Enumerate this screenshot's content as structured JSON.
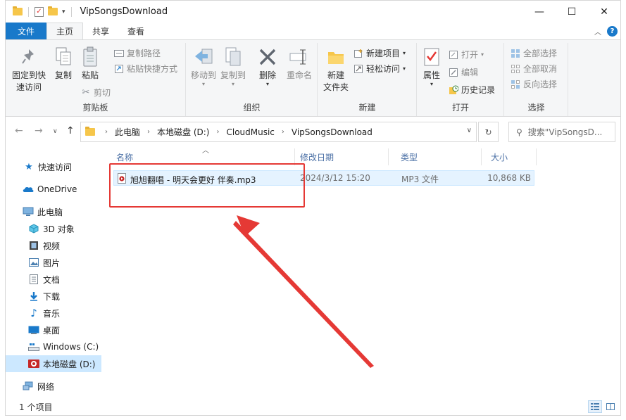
{
  "window": {
    "title": "VipSongsDownload",
    "controls": {
      "minimize": "—",
      "maximize": "☐",
      "close": "✕"
    }
  },
  "tabs": [
    {
      "label": "文件"
    },
    {
      "label": "主页"
    },
    {
      "label": "共享"
    },
    {
      "label": "查看"
    }
  ],
  "ribbon": {
    "clipboard": {
      "label": "剪贴板",
      "pin": "固定到快\n速访问",
      "copy": "复制",
      "paste": "粘贴",
      "copy_path": "复制路径",
      "paste_shortcut": "粘贴快捷方式",
      "cut": "剪切"
    },
    "organize": {
      "label": "组织",
      "move_to": "移动到",
      "copy_to": "复制到",
      "delete": "删除",
      "rename": "重命名"
    },
    "new": {
      "label": "新建",
      "new_folder": "新建\n文件夹",
      "new_item": "新建项目",
      "easy_access": "轻松访问"
    },
    "open": {
      "label": "打开",
      "properties": "属性",
      "open": "打开",
      "edit": "编辑",
      "history": "历史记录"
    },
    "select": {
      "label": "选择",
      "select_all": "全部选择",
      "select_none": "全部取消",
      "invert": "反向选择"
    }
  },
  "address": {
    "crumbs": [
      "此电脑",
      "本地磁盘 (D:)",
      "CloudMusic",
      "VipSongsDownload"
    ],
    "search_placeholder": "搜索\"VipSongsD..."
  },
  "sidebar": {
    "items": [
      {
        "label": "快速访问",
        "icon": "star-icon"
      },
      {
        "label": "OneDrive",
        "icon": "cloud-icon"
      },
      {
        "label": "此电脑",
        "icon": "computer-icon"
      },
      {
        "label": "3D 对象",
        "icon": "cube-icon"
      },
      {
        "label": "视频",
        "icon": "video-icon"
      },
      {
        "label": "图片",
        "icon": "picture-icon"
      },
      {
        "label": "文档",
        "icon": "document-icon"
      },
      {
        "label": "下载",
        "icon": "download-icon"
      },
      {
        "label": "音乐",
        "icon": "music-icon"
      },
      {
        "label": "桌面",
        "icon": "desktop-icon"
      },
      {
        "label": "Windows (C:)",
        "icon": "drive-icon"
      },
      {
        "label": "本地磁盘 (D:)",
        "icon": "drive-icon",
        "selected": true
      },
      {
        "label": "网络",
        "icon": "network-icon"
      }
    ]
  },
  "columns": [
    "名称",
    "修改日期",
    "类型",
    "大小"
  ],
  "files": [
    {
      "name": "旭旭翻唱 - 明天会更好 伴奏.mp3",
      "modified": "2024/3/12 15:20",
      "type": "MP3 文件",
      "size": "10,868 KB"
    }
  ],
  "status": {
    "count": "1 个项目"
  },
  "colors": {
    "accent": "#1979ca",
    "highlight_box": "#e53935",
    "selection": "#cce8ff"
  }
}
